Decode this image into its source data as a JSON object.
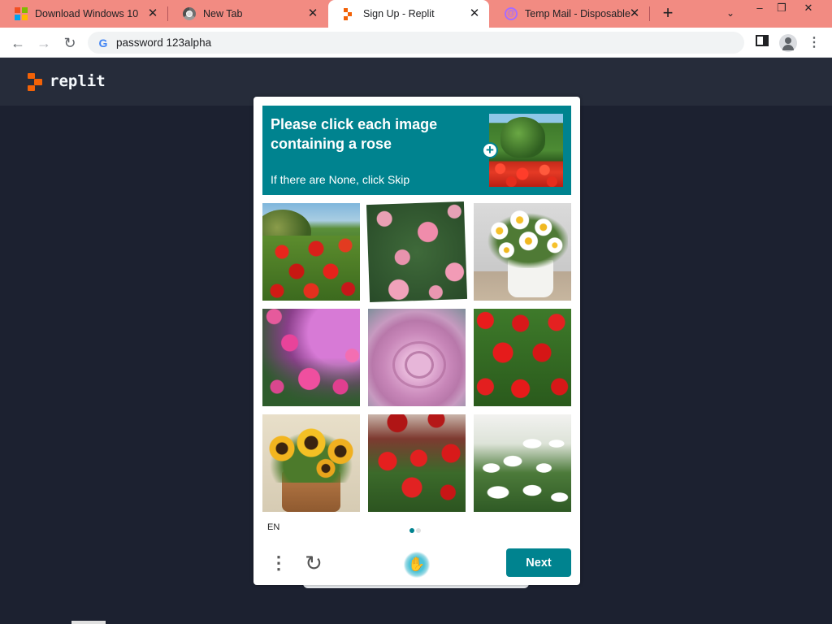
{
  "browser": {
    "tabs": [
      {
        "title": "Download Windows 10",
        "favicon": "windows-logo-icon",
        "active": false
      },
      {
        "title": "New Tab",
        "favicon": "chrome-icon",
        "active": false
      },
      {
        "title": "Sign Up - Replit",
        "favicon": "replit-icon",
        "active": true
      },
      {
        "title": "Temp Mail - Disposable",
        "favicon": "at-sign-icon",
        "active": false
      }
    ],
    "tab_close_glyph": "✕",
    "new_tab_glyph": "+",
    "address_bar": {
      "value": "password 123alpha"
    },
    "window_controls": {
      "minimize": "–",
      "restore": "❐",
      "close": "✕"
    },
    "colors": {
      "tabstrip": "#f28b82",
      "active_tab": "#ffffff"
    }
  },
  "site": {
    "brand": "replit",
    "colors": {
      "page_bg": "#1c2130",
      "header_bg": "#262c3a",
      "logo": "#f26207"
    }
  },
  "captcha": {
    "prompt_title": "Please click each image containing a rose",
    "prompt_subtitle": "If there are None, click Skip",
    "example_image": "rose-garden",
    "tiles": [
      {
        "content": "red-roses-bush"
      },
      {
        "content": "pink-roses"
      },
      {
        "content": "white-daisies-pot"
      },
      {
        "content": "pink-roses-bokeh"
      },
      {
        "content": "pink-rose-closeup"
      },
      {
        "content": "red-roses-bed"
      },
      {
        "content": "sunflowers-pot"
      },
      {
        "content": "red-roses-bouquet"
      },
      {
        "content": "white-daisies-field"
      }
    ],
    "language": "EN",
    "page_dots": [
      {
        "active": true
      },
      {
        "active": false
      }
    ],
    "next_label": "Next",
    "colors": {
      "accent": "#00838f",
      "dot_active": "#00838f",
      "dot_inactive": "#e0e0e0"
    }
  }
}
